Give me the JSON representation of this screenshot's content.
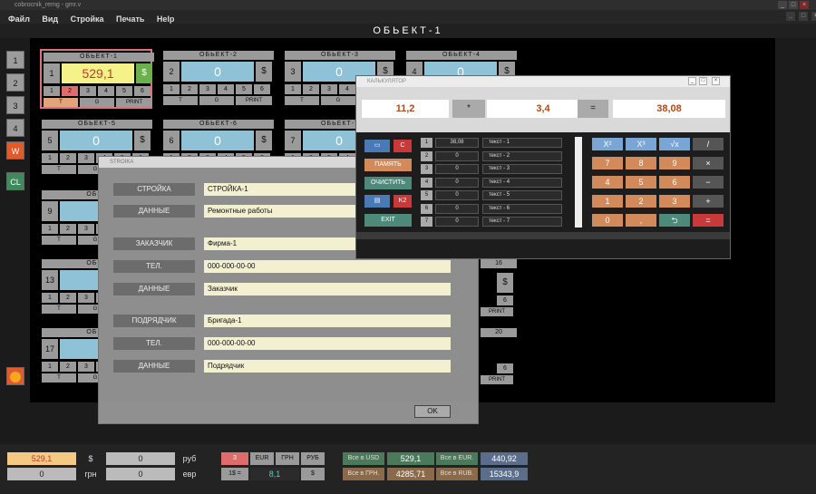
{
  "window": {
    "title": "cobrocnik_remg - gmr.v",
    "main_title": "ОБЬЕКТ-1"
  },
  "menu": [
    "Файл",
    "Вид",
    "Стройка",
    "Печать",
    "Help"
  ],
  "side_buttons": [
    "1",
    "2",
    "3",
    "4",
    "W",
    "CL"
  ],
  "cards": [
    {
      "title": "ОБЬЕКТ-1",
      "num": "1",
      "value": "529,1"
    },
    {
      "title": "ОБЬЕКТ-2",
      "num": "2",
      "value": "0"
    },
    {
      "title": "ОБЬЕКТ-3",
      "num": "3",
      "value": "0"
    },
    {
      "title": "ОБЬЕКТ-4",
      "num": "4",
      "value": "0"
    },
    {
      "title": "ОБЬЕКТ-5",
      "num": "5",
      "value": "0"
    },
    {
      "title": "ОБЬЕКТ-6",
      "num": "6",
      "value": "0"
    },
    {
      "title": "ОБЬЕКТ-7",
      "num": "7",
      "value": "0"
    }
  ],
  "card_labels": {
    "dollar": "$",
    "n1": "1",
    "n2": "2",
    "n3": "3",
    "n4": "4",
    "n5": "5",
    "n6": "6",
    "t": "T",
    "g": "G",
    "print": "PRINT"
  },
  "partial": {
    "r3_num": "9",
    "r3_title": "ОБЬЕ",
    "r4_num": "13",
    "r4_title": "ОБЬЕ",
    "r5_num": "17",
    "r5_title": "ОБЬЕ",
    "right_r4": "16",
    "right_r5": "20"
  },
  "stroika": {
    "title": "STROIKA",
    "rows": [
      {
        "label": "СТРОЙКА",
        "value": "СТРОЙКА-1"
      },
      {
        "label": "ДАННЫЕ",
        "value": "Ремонтные работы"
      },
      {
        "label": "ЗАКАЗЧИК",
        "value": "Фирма-1"
      },
      {
        "label": "ТЕЛ.",
        "value": "000-000-00-00"
      },
      {
        "label": "ДАННЫЕ",
        "value": "Заказчик"
      },
      {
        "label": "ПОДРЯДЧИК",
        "value": "Бригада-1"
      },
      {
        "label": "ТЕЛ.",
        "value": "000-000-00-00"
      },
      {
        "label": "ДАННЫЕ",
        "value": "Подрядчик"
      }
    ],
    "ok": "OK"
  },
  "calc": {
    "title": "КАЛЬКУЛЯТОР",
    "a": "11,2",
    "op": "*",
    "b": "3,4",
    "eq": "=",
    "result": "38,08",
    "left_buttons": {
      "c": "C",
      "memory": "ПАМЯТЬ",
      "clear": "ОЧИСТИТЬ",
      "k2": "K2",
      "exit": "EXIT"
    },
    "memory": [
      {
        "i": "1",
        "v": "38,08",
        "t": "текст - 1"
      },
      {
        "i": "2",
        "v": "0",
        "t": "текст - 2"
      },
      {
        "i": "3",
        "v": "0",
        "t": "текст - 3"
      },
      {
        "i": "4",
        "v": "0",
        "t": "текст - 4"
      },
      {
        "i": "5",
        "v": "0",
        "t": "текст - 5"
      },
      {
        "i": "6",
        "v": "0",
        "t": "текст - 6"
      },
      {
        "i": "7",
        "v": "0",
        "t": "текст - 7"
      }
    ],
    "keys": [
      [
        "X²",
        "X³",
        "√x",
        "/"
      ],
      [
        "7",
        "8",
        "9",
        "×"
      ],
      [
        "4",
        "5",
        "6",
        "−"
      ],
      [
        "1",
        "2",
        "3",
        "+"
      ],
      [
        "0",
        ",",
        "⮌",
        "="
      ]
    ]
  },
  "bottom": {
    "v1": "529,1",
    "c1": "$",
    "v2": "0",
    "c2": "руб",
    "v3": "0",
    "c3": "грн",
    "v4": "0",
    "c4": "евр",
    "btn3": "3",
    "eur": "EUR",
    "grn": "ГРН",
    "rub": "РУБ",
    "rate_label": "1$ =",
    "rate": "8,1",
    "rate_cur": "$",
    "usd_label": "Все в USD",
    "usd": "529,1",
    "eur_label": "Все в EUR.",
    "eur_val": "440,92",
    "grn_label": "Все в ГРН.",
    "grn_val": "4285,71",
    "rub_label": "Все в RUB.",
    "rub_val": "15343,9"
  }
}
